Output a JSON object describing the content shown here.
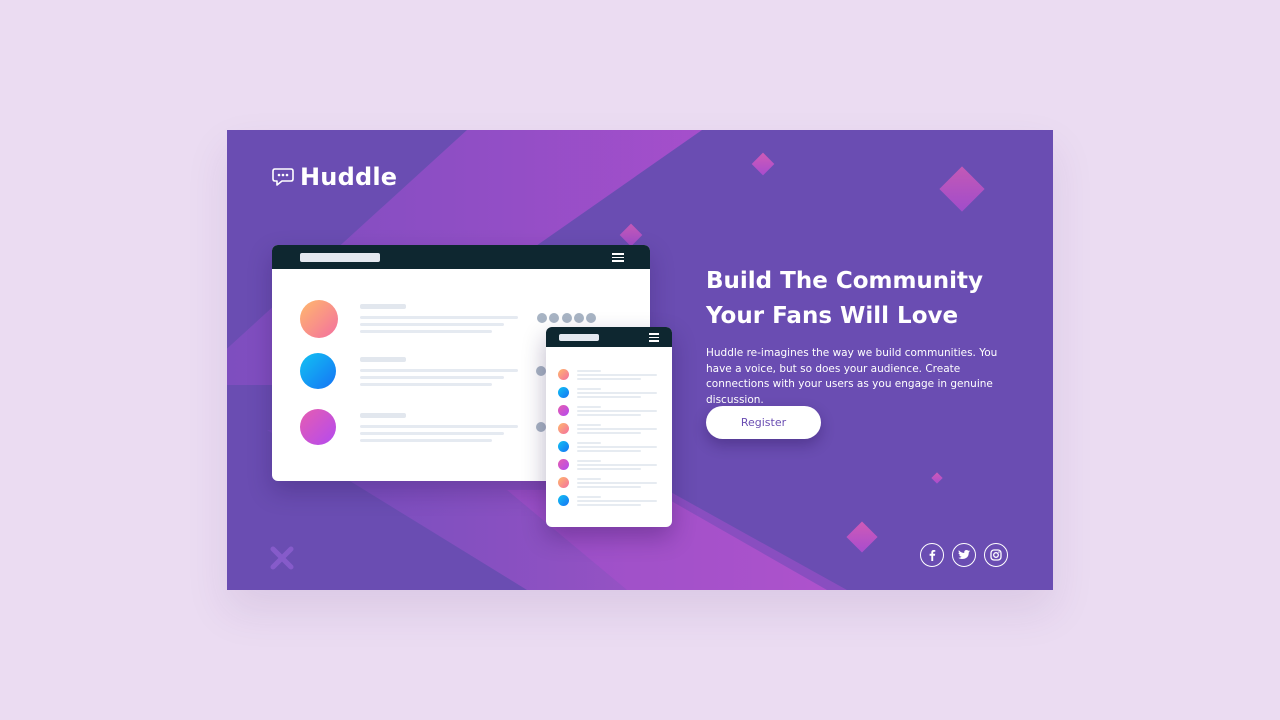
{
  "brand": {
    "name": "Huddle"
  },
  "hero": {
    "headline_line1": "Build The Community",
    "headline_line2": "Your Fans Will Love",
    "description": "Huddle re-imagines the way we build communities. You have a voice, but so does your audience. Create connections with your users as you engage in genuine discussion.",
    "register_label": "Register"
  },
  "social": {
    "links": [
      {
        "icon": "facebook-icon"
      },
      {
        "icon": "twitter-icon"
      },
      {
        "icon": "instagram-icon"
      }
    ]
  },
  "colors": {
    "page_background": "#EBDCF2",
    "card_background": "#6A4DB2",
    "accent_pink": "#C85BCE",
    "dark_bar": "#0E2730",
    "button_text": "#6A4DB2"
  }
}
